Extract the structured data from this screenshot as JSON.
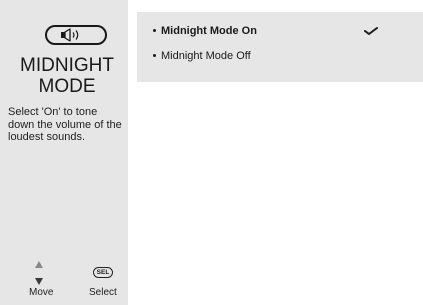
{
  "sidebar": {
    "icon": "speaker-icon",
    "title_line1": "MIDNIGHT",
    "title_line2": "MODE",
    "description": "Select 'On' to tone down the volume of the loudest sounds.",
    "nav": {
      "move_label": "Move",
      "select_label": "Select",
      "sel_button_text": "SEL"
    }
  },
  "menu": {
    "options": [
      {
        "label": "Midnight Mode On",
        "selected": true
      },
      {
        "label": "Midnight Mode Off",
        "selected": false
      }
    ],
    "check_icon": "checkmark-icon"
  }
}
